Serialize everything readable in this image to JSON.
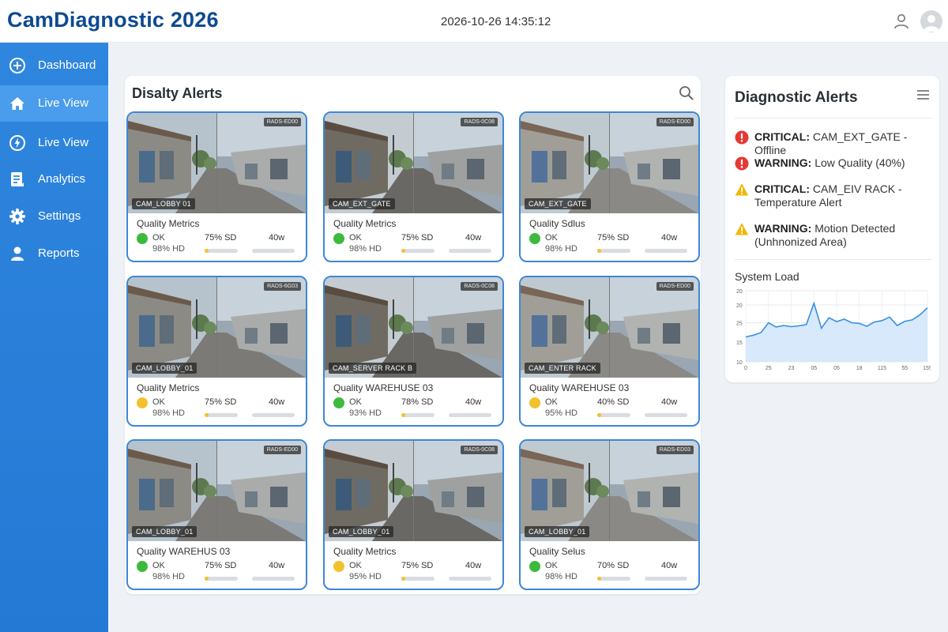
{
  "header": {
    "title": "CamDiagnostic 2026",
    "datetime": "2026-10-26 14:35:12"
  },
  "sidebar": {
    "items": [
      {
        "label": "Dashboard",
        "icon": "plus-circle-icon",
        "active": false
      },
      {
        "label": "Live View",
        "icon": "home-icon",
        "active": true
      },
      {
        "label": "Live View",
        "icon": "bolt-circle-icon",
        "active": false
      },
      {
        "label": "Analytics",
        "icon": "document-icon",
        "active": false
      },
      {
        "label": "Settings",
        "icon": "gear-icon",
        "active": false
      },
      {
        "label": "Reports",
        "icon": "user-icon",
        "active": false
      }
    ]
  },
  "main": {
    "title": "Disalty Alerts",
    "cameras": [
      {
        "name": "CAM_LOBBY 01",
        "badge": "RADS-ED00",
        "quality_title": "Quality Metrics",
        "status": "OK",
        "status_color": "#3cba3c",
        "hd": "98% HD",
        "sd": "75% SD",
        "watt": "40w",
        "bar": 0.05
      },
      {
        "name": "CAM_EXT_GATE",
        "badge": "RADS-0C08",
        "quality_title": "Quality Metrics",
        "status": "OK",
        "status_color": "#3cba3c",
        "hd": "98% HD",
        "sd": "75% SD",
        "watt": "40w",
        "bar": 0.05
      },
      {
        "name": "CAM_EXT_GATE",
        "badge": "RADS-ED00",
        "quality_title": "Quality Sdlus",
        "status": "OK",
        "status_color": "#3cba3c",
        "hd": "98% HD",
        "sd": "75% SD",
        "watt": "40w",
        "bar": 0.05
      },
      {
        "name": "CAM_LOBBY_01",
        "badge": "RADS-6G03",
        "quality_title": "Quality Metrics",
        "status": "OK",
        "status_color": "#f2c12e",
        "hd": "98% HD",
        "sd": "75% SD",
        "watt": "40w",
        "bar": 0
      },
      {
        "name": "CAM_SERVER RACK B",
        "badge": "RADS-0C08",
        "quality_title": "Quality WAREHUSE 03",
        "status": "OK",
        "status_color": "#3cba3c",
        "hd": "93% HD",
        "sd": "78% SD",
        "watt": "40w",
        "bar": 0
      },
      {
        "name": "CAM_ENTER RACK",
        "badge": "RADS-ED00",
        "quality_title": "Quality WAREHUSE 03",
        "status": "OK",
        "status_color": "#f2c12e",
        "hd": "95% HD",
        "sd": "40% SD",
        "watt": "40w",
        "bar": 0
      },
      {
        "name": "CAM_LOBBY_01",
        "badge": "RADS-ED00",
        "quality_title": "Quality WAREHUS 03",
        "status": "OK",
        "status_color": "#3cba3c",
        "hd": "98% HD",
        "sd": "75% SD",
        "watt": "40w",
        "bar": 0.05
      },
      {
        "name": "CAM_LOBBY_01",
        "badge": "RADS-0C08",
        "quality_title": "Quality Metrics",
        "status": "OK",
        "status_color": "#f2c12e",
        "hd": "95% HD",
        "sd": "75% SD",
        "watt": "40w",
        "bar": 0.05
      },
      {
        "name": "CAM_LOBBY_01",
        "badge": "RADS-ED03",
        "quality_title": "Quality Selus",
        "status": "OK",
        "status_color": "#3cba3c",
        "hd": "98% HD",
        "sd": "70% SD",
        "watt": "40w",
        "bar": 0.05
      }
    ]
  },
  "alerts": {
    "title": "Diagnostic Alerts",
    "items": [
      {
        "level": "CRITICAL:",
        "text": "CAM_EXT_GATE - Offline",
        "icon": "critical-icon"
      },
      {
        "level": "WARNING:",
        "text": "Low Quality (40%)",
        "icon": "critical-icon"
      },
      {
        "level": "CRITICAL:",
        "text": "CAM_EIV RACK - Temperature Alert",
        "icon": "warning-icon"
      },
      {
        "level": "WARNING:",
        "text": "Motion Detected (Unhnonized Area)",
        "icon": "warning-icon"
      }
    ],
    "system_load": {
      "title": "System Load",
      "chart_data": {
        "type": "area",
        "title": "System Load",
        "y_ticks": [
          "20",
          "20",
          "25",
          "15",
          "10"
        ],
        "x_ticks": [
          "0",
          "25",
          "23",
          "05",
          "05",
          "18",
          "115",
          "55",
          "155"
        ],
        "series": [
          {
            "values": [
              17,
              17.5,
              18.2,
              21,
              19.8,
              20.2,
              19.9,
              20.1,
              20.5,
              26.5,
              19.5,
              22.4,
              21.3,
              22,
              21,
              20.8,
              20,
              21.2,
              21.6,
              22.6,
              20.2,
              21.4,
              21.8,
              23.2,
              25.2
            ]
          }
        ],
        "colors": {
          "line": "#3a8fe0",
          "fill": "#d7e9fa"
        }
      }
    }
  }
}
